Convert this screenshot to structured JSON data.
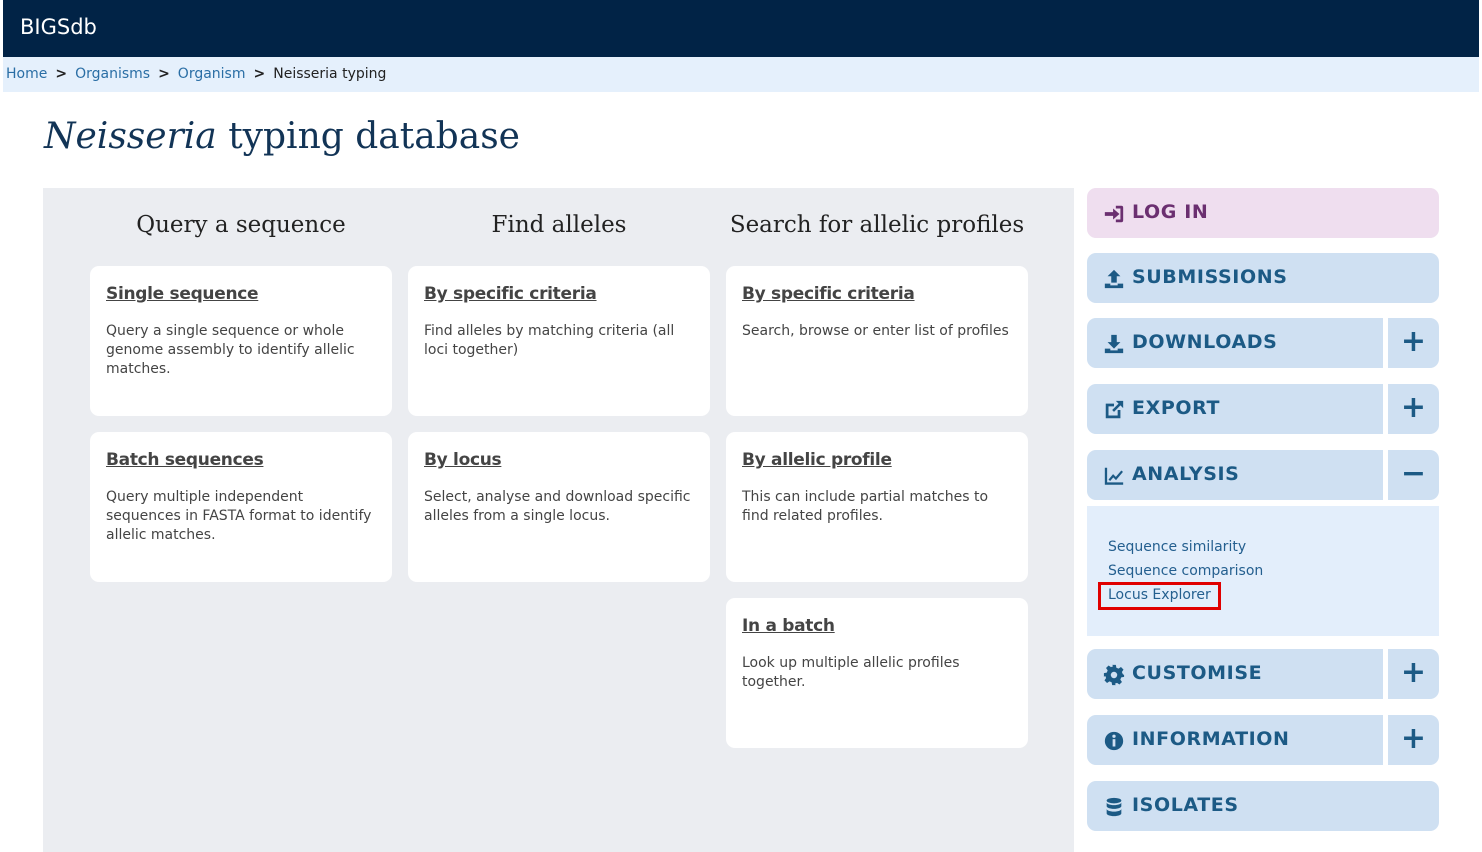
{
  "header": {
    "brand": "BIGSdb"
  },
  "breadcrumb": {
    "items": [
      "Home",
      "Organisms",
      "Organism"
    ],
    "separator": ">",
    "current": "Neisseria typing"
  },
  "page": {
    "title_italic": "Neisseria",
    "title_rest": " typing database"
  },
  "columns": [
    {
      "heading": "Query a sequence",
      "cards": [
        {
          "title": "Single sequence",
          "desc": "Query a single sequence or whole genome assembly to identify allelic matches."
        },
        {
          "title": "Batch sequences",
          "desc": "Query multiple independent sequences in FASTA format to identify allelic matches."
        }
      ]
    },
    {
      "heading": "Find alleles",
      "cards": [
        {
          "title": "By specific criteria",
          "desc": "Find alleles by matching criteria (all loci together)"
        },
        {
          "title": "By locus",
          "desc": "Select, analyse and download specific alleles from a single locus."
        }
      ]
    },
    {
      "heading": "Search for allelic profiles",
      "cards": [
        {
          "title": "By specific criteria",
          "desc": "Search, browse or enter list of profiles"
        },
        {
          "title": "By allelic profile",
          "desc": "This can include partial matches to find related profiles."
        },
        {
          "title": "In a batch",
          "desc": "Look up multiple allelic profiles together."
        }
      ]
    }
  ],
  "sidebar": {
    "login": "LOG IN",
    "submissions": "SUBMISSIONS",
    "downloads": "DOWNLOADS",
    "export": "EXPORT",
    "analysis": "ANALYSIS",
    "customise": "CUSTOMISE",
    "information": "INFORMATION",
    "isolates": "ISOLATES",
    "expand_symbol": "+",
    "collapse_symbol": "−",
    "analysis_links": [
      "Sequence similarity",
      "Sequence comparison",
      "Locus Explorer"
    ]
  },
  "colors": {
    "header_bg": "#012346",
    "breadcrumb_bg": "#e5f0fc",
    "panel_bg": "#ebedf1",
    "sidebar_bg": "#cfe0f2",
    "login_bg": "#efdeef",
    "highlight": "#e00000"
  },
  "icons": {
    "login": "sign-in-icon",
    "submissions": "upload-icon",
    "downloads": "download-icon",
    "export": "external-link-icon",
    "analysis": "chart-icon",
    "customise": "gear-icon",
    "information": "info-icon",
    "isolates": "database-icon"
  }
}
